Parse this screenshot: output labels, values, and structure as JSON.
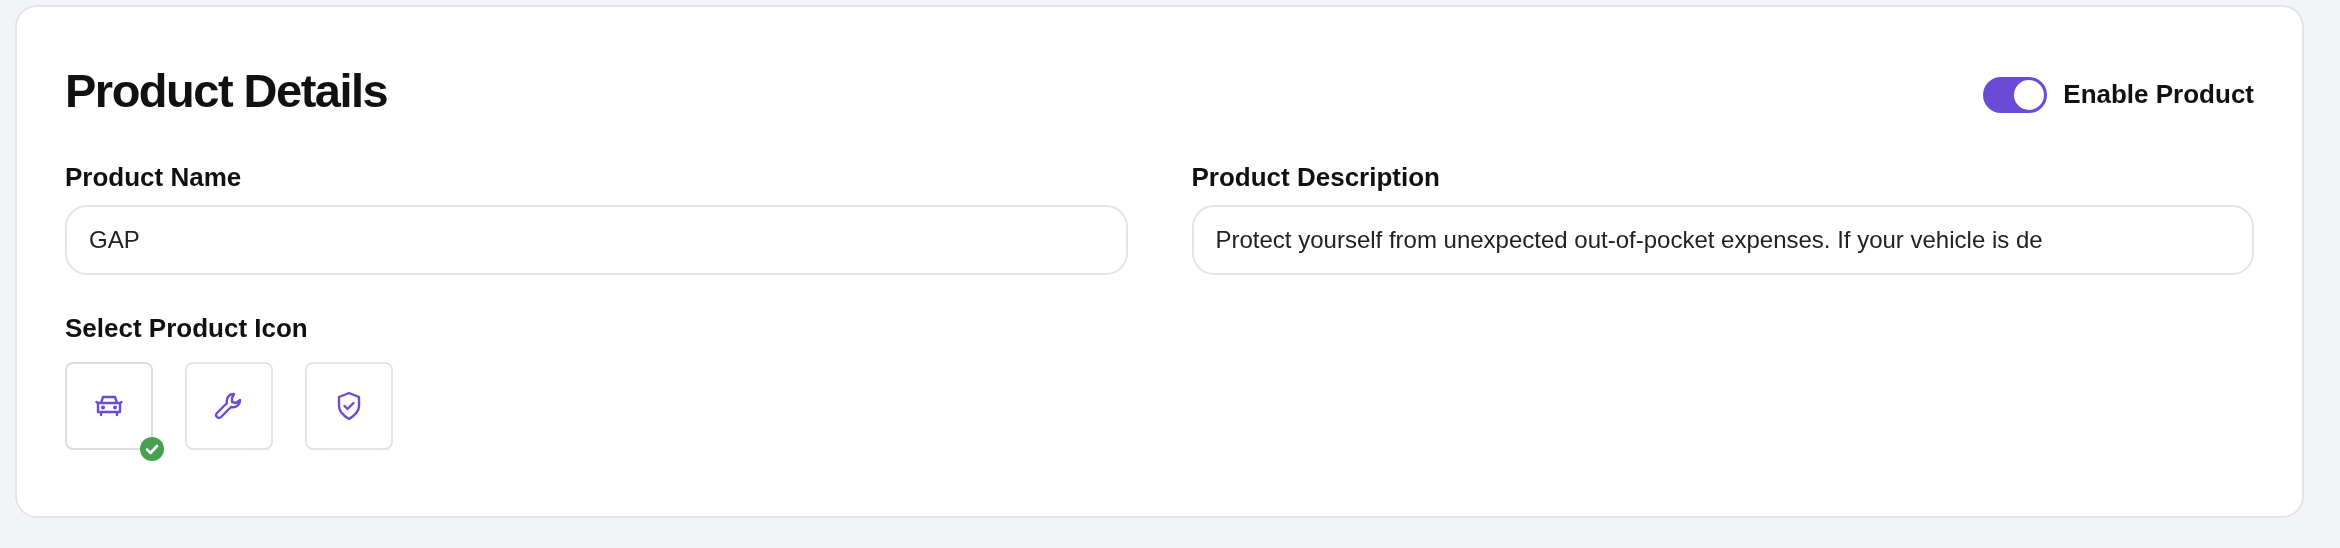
{
  "title": "Product Details",
  "enable_toggle": {
    "label": "Enable Product",
    "on": true
  },
  "fields": [
    {
      "label": "Product Name",
      "value": "GAP"
    },
    {
      "label": "Product Description",
      "value": "Protect yourself from unexpected out-of-pocket expenses. If your vehicle is de"
    }
  ],
  "icon_picker": {
    "label": "Select Product Icon",
    "options": [
      {
        "kind": "car",
        "selected": true
      },
      {
        "kind": "wrench",
        "selected": false
      },
      {
        "kind": "shield",
        "selected": false
      }
    ]
  }
}
